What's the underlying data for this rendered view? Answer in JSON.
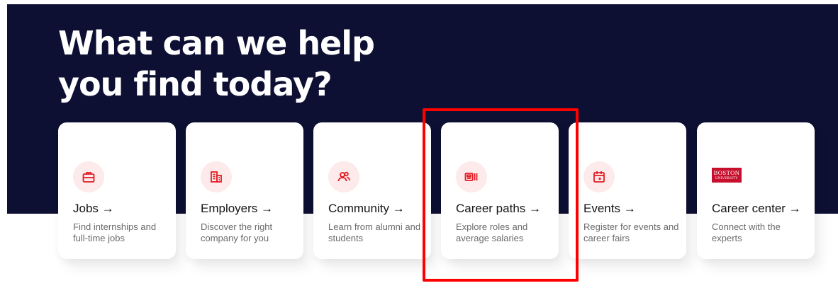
{
  "hero": {
    "title_line1": "What can we help",
    "title_line2": "you find today?",
    "background_color": "#0d1033"
  },
  "accent_color": "#e31b23",
  "cards": [
    {
      "title": "Jobs →",
      "description": "Find internships and full-time jobs",
      "icon": "briefcase-icon"
    },
    {
      "title": "Employers →",
      "description": "Discover the right company for you",
      "icon": "building-icon"
    },
    {
      "title": "Community →",
      "description": "Learn from alumni and students",
      "icon": "people-icon"
    },
    {
      "title": "Career paths →",
      "description": "Explore roles and average salaries",
      "icon": "career-paths-icon"
    },
    {
      "title": "Events →",
      "description": "Register for events and career fairs",
      "icon": "calendar-icon"
    },
    {
      "title": "Career center →",
      "description": "Connect with the experts",
      "icon": "boston-university-logo",
      "logo_text_line1": "BOSTON",
      "logo_text_line2": "UNIVERSITY"
    }
  ],
  "highlight": {
    "target": "Career paths →",
    "color": "#ff0000"
  }
}
